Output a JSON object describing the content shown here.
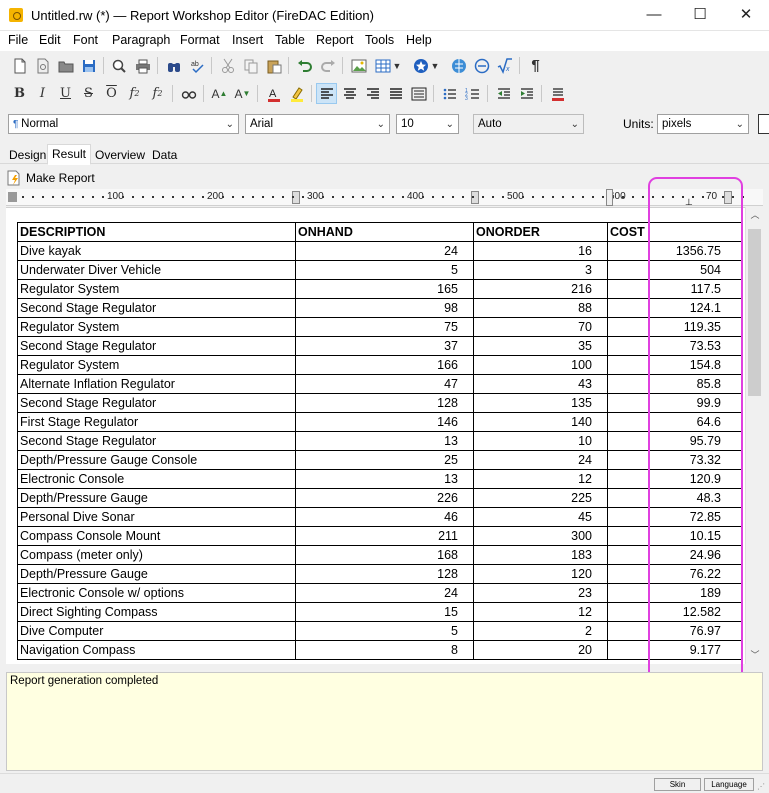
{
  "window": {
    "title": "Untitled.rw (*) — Report Workshop Editor (FireDAC Edition)",
    "minimize": "—",
    "maximize": "☐",
    "close": "✕"
  },
  "menu": [
    "File",
    "Edit",
    "Font",
    "Paragraph",
    "Format",
    "Insert",
    "Table",
    "Report",
    "Tools",
    "Help"
  ],
  "format_bar": {
    "style": "Normal",
    "font": "Arial",
    "size": "10",
    "color_mode": "Auto",
    "units_label": "Units:",
    "units": "pixels"
  },
  "tabs": [
    "Design",
    "Result",
    "Overview",
    "Data"
  ],
  "active_tab": "Result",
  "make_report_label": "Make Report",
  "ruler_labels": [
    "100",
    "200",
    "300",
    "400",
    "500",
    "600",
    "70"
  ],
  "table": {
    "headers": [
      "DESCRIPTION",
      "ONHAND",
      "ONORDER",
      "COST"
    ],
    "rows": [
      [
        "Dive kayak",
        "24",
        "16",
        "1356.75"
      ],
      [
        "Underwater Diver Vehicle",
        "5",
        "3",
        "504"
      ],
      [
        "Regulator System",
        "165",
        "216",
        "117.5"
      ],
      [
        "Second Stage Regulator",
        "98",
        "88",
        "124.1"
      ],
      [
        "Regulator System",
        "75",
        "70",
        "119.35"
      ],
      [
        "Second Stage Regulator",
        "37",
        "35",
        "73.53"
      ],
      [
        "Regulator System",
        "166",
        "100",
        "154.8"
      ],
      [
        "Alternate Inflation Regulator",
        "47",
        "43",
        "85.8"
      ],
      [
        "Second Stage Regulator",
        "128",
        "135",
        "99.9"
      ],
      [
        "First Stage Regulator",
        "146",
        "140",
        "64.6"
      ],
      [
        "Second Stage Regulator",
        "13",
        "10",
        "95.79"
      ],
      [
        "Depth/Pressure Gauge Console",
        "25",
        "24",
        "73.32"
      ],
      [
        "Electronic Console",
        "13",
        "12",
        "120.9"
      ],
      [
        "Depth/Pressure Gauge",
        "226",
        "225",
        "48.3"
      ],
      [
        "Personal Dive Sonar",
        "46",
        "45",
        "72.85"
      ],
      [
        "Compass Console Mount",
        "211",
        "300",
        "10.15"
      ],
      [
        "Compass (meter only)",
        "168",
        "183",
        "24.96"
      ],
      [
        "Depth/Pressure Gauge",
        "128",
        "120",
        "76.22"
      ],
      [
        "Electronic Console w/ options",
        "24",
        "23",
        "189"
      ],
      [
        "Direct Sighting Compass",
        "15",
        "12",
        "12.582"
      ],
      [
        "Dive Computer",
        "5",
        "2",
        "76.97"
      ],
      [
        "Navigation Compass",
        "8",
        "20",
        "9.177"
      ]
    ]
  },
  "log_message": "Report generation completed",
  "status": {
    "skin_label": "Skin",
    "language_label": "Language"
  },
  "colors": {
    "highlight": "#e040e0",
    "log_background": "#ffffe1"
  }
}
